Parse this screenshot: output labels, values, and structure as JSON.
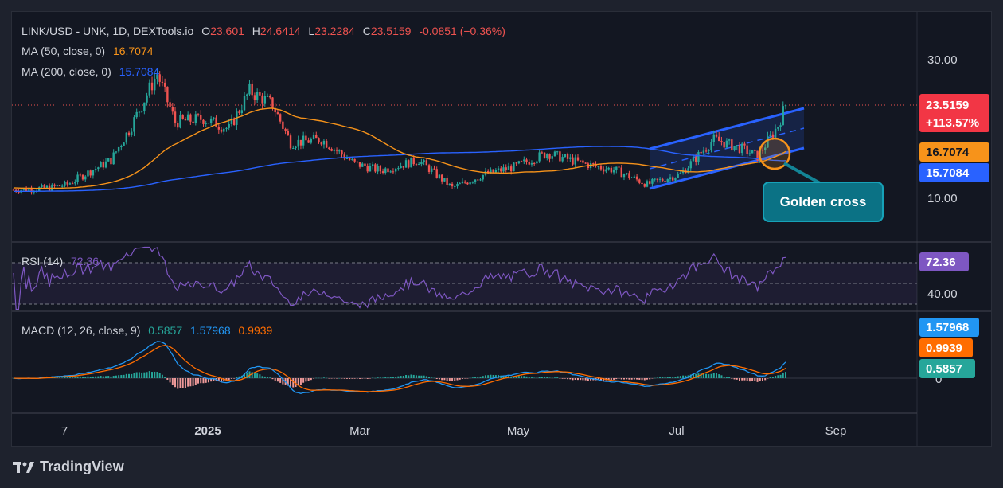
{
  "header": {
    "symbol": "LINK/USD - UNK, 1D, DEXTools.io",
    "o_label": "O",
    "o_value": "23.601",
    "h_label": "H",
    "h_value": "24.6414",
    "l_label": "L",
    "l_value": "23.2284",
    "c_label": "C",
    "c_value": "23.5159",
    "change": "-0.0851 (−0.36%)"
  },
  "indicators": {
    "ma50_label": "MA (50, close, 0)",
    "ma50_value": "16.7074",
    "ma200_label": "MA (200, close, 0)",
    "ma200_value": "15.7084",
    "rsi_label": "RSI (14)",
    "rsi_value": "72.36",
    "macd_label": "MACD (12, 26, close, 9)",
    "macd_hist_value": "0.5857",
    "macd_value": "1.57968",
    "macd_signal_value": "0.9939"
  },
  "price_tags": {
    "last": "23.5159",
    "last_change": "+113.57%",
    "ma50": "16.7074",
    "ma200": "15.7084",
    "rsi": "72.36",
    "macd": "1.57968",
    "signal": "0.9939",
    "hist": "0.5857"
  },
  "annotation": {
    "callout": "Golden cross"
  },
  "brand": {
    "name": "TradingView"
  },
  "colors": {
    "background": "#131722",
    "up": "#26a69a",
    "down": "#ef5350",
    "ma50": "#f7931a",
    "ma200": "#2962ff",
    "rsi": "#7e57c2",
    "macd": "#2196f3",
    "signal": "#ff6d00",
    "callout": "#0b7285"
  },
  "chart_data": {
    "type": "candlestick",
    "x_ticks": [
      "7",
      "2025",
      "Mar",
      "May",
      "Jul",
      "Sep"
    ],
    "price_axis": {
      "ticks": [
        "10.00",
        "30.00"
      ],
      "range": [
        8,
        33
      ]
    },
    "rsi_axis": {
      "ticks": [
        "40.00"
      ],
      "levels": [
        70,
        50,
        30
      ]
    },
    "macd_axis": {
      "ticks": [
        "0"
      ]
    },
    "close_path": [
      {
        "date": "2024-10-18",
        "close": 11.2
      },
      {
        "date": "2024-11-01",
        "close": 11.5
      },
      {
        "date": "2024-11-08",
        "close": 12.0
      },
      {
        "date": "2024-11-15",
        "close": 13.5
      },
      {
        "date": "2024-11-25",
        "close": 15.5
      },
      {
        "date": "2024-12-03",
        "close": 20.5
      },
      {
        "date": "2024-12-13",
        "close": 28.0
      },
      {
        "date": "2024-12-20",
        "close": 21.0
      },
      {
        "date": "2024-12-31",
        "close": 21.5
      },
      {
        "date": "2025-01-10",
        "close": 20.0
      },
      {
        "date": "2025-01-18",
        "close": 25.5
      },
      {
        "date": "2025-01-27",
        "close": 23.5
      },
      {
        "date": "2025-02-03",
        "close": 18.0
      },
      {
        "date": "2025-02-15",
        "close": 18.5
      },
      {
        "date": "2025-02-28",
        "close": 15.0
      },
      {
        "date": "2025-03-10",
        "close": 14.0
      },
      {
        "date": "2025-03-25",
        "close": 15.5
      },
      {
        "date": "2025-04-07",
        "close": 11.5
      },
      {
        "date": "2025-04-20",
        "close": 13.5
      },
      {
        "date": "2025-05-01",
        "close": 14.5
      },
      {
        "date": "2025-05-14",
        "close": 16.5
      },
      {
        "date": "2025-05-28",
        "close": 15.0
      },
      {
        "date": "2025-06-10",
        "close": 14.0
      },
      {
        "date": "2025-06-22",
        "close": 12.0
      },
      {
        "date": "2025-07-05",
        "close": 13.5
      },
      {
        "date": "2025-07-18",
        "close": 18.5
      },
      {
        "date": "2025-07-30",
        "close": 17.0
      },
      {
        "date": "2025-08-04",
        "close": 16.0
      },
      {
        "date": "2025-08-12",
        "close": 20.5
      },
      {
        "date": "2025-08-15",
        "close": 23.5
      }
    ],
    "series": [
      {
        "name": "MA (50, close, 0)",
        "last": 16.7074
      },
      {
        "name": "MA (200, close, 0)",
        "last": 15.7084
      },
      {
        "name": "RSI (14)",
        "last": 72.36
      },
      {
        "name": "MACD (12, 26, close, 9)",
        "macd": 1.57968,
        "signal": 0.9939,
        "hist": 0.5857
      }
    ],
    "annotations": [
      "Golden cross",
      "rising channel"
    ]
  }
}
